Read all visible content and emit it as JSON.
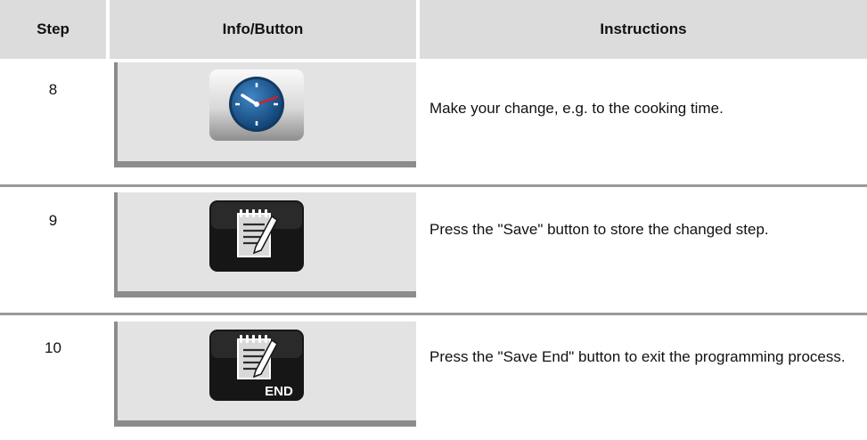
{
  "header": {
    "step": "Step",
    "info": "Info/Button",
    "instructions": "Instructions"
  },
  "rows": [
    {
      "step": "8",
      "icon": "clock-icon",
      "instruction": "Make your change, e.g. to the cooking time."
    },
    {
      "step": "9",
      "icon": "save-icon",
      "instruction": "Press the \"Save\" button to store the changed step."
    },
    {
      "step": "10",
      "icon": "save-end-icon",
      "icon_label": "END",
      "instruction": "Press the \"Save End\" button to exit the programming process."
    }
  ],
  "colors": {
    "header_bg": "#dcdcdc",
    "panel_bg": "#e3e3e3",
    "panel_shadow": "#8c8c8c",
    "divider": "#9a9a9a",
    "clock_face": "#1f5d96",
    "clock_hand": "#d62020"
  }
}
